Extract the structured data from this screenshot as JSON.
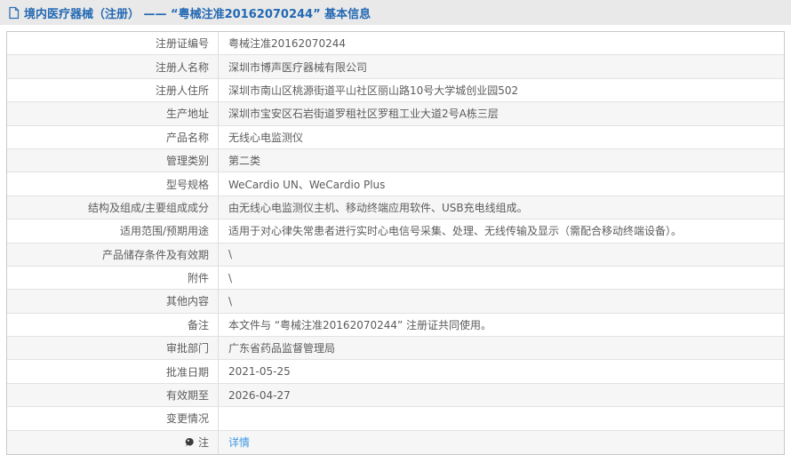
{
  "header": {
    "title": "境内医疗器械（注册） —— “粤械注准20162070244” 基本信息"
  },
  "colors": {
    "title_blue": "#2369b3",
    "link_blue": "#3e97e0",
    "header_bg": "#e9e9e9",
    "alt_row_bg": "#f6f6f6"
  },
  "icons": {
    "header": "document-icon",
    "note": "note-balloon-icon"
  },
  "table": {
    "rows": [
      {
        "label": "注册证编号",
        "value": "粤械注准20162070244"
      },
      {
        "label": "注册人名称",
        "value": "深圳市博声医疗器械有限公司"
      },
      {
        "label": "注册人住所",
        "value": "深圳市南山区桃源街道平山社区丽山路10号大学城创业园502"
      },
      {
        "label": "生产地址",
        "value": "深圳市宝安区石岩街道罗租社区罗租工业大道2号A栋三层"
      },
      {
        "label": "产品名称",
        "value": "无线心电监测仪"
      },
      {
        "label": "管理类别",
        "value": "第二类"
      },
      {
        "label": "型号规格",
        "value": "WeCardio UN、WeCardio Plus"
      },
      {
        "label": "结构及组成/主要组成成分",
        "value": "由无线心电监测仪主机、移动终端应用软件、USB充电线组成。"
      },
      {
        "label": "适用范围/预期用途",
        "value": "适用于对心律失常患者进行实时心电信号采集、处理、无线传输及显示（需配合移动终端设备）。"
      },
      {
        "label": "产品储存条件及有效期",
        "value": "\\"
      },
      {
        "label": "附件",
        "value": "\\"
      },
      {
        "label": "其他内容",
        "value": "\\"
      },
      {
        "label": "备注",
        "value": "本文件与 “粤械注准20162070244” 注册证共同使用。"
      },
      {
        "label": "审批部门",
        "value": "广东省药品监督管理局"
      },
      {
        "label": "批准日期",
        "value": "2021-05-25"
      },
      {
        "label": "有效期至",
        "value": "2026-04-27"
      },
      {
        "label": "变更情况",
        "value": ""
      },
      {
        "label": "注",
        "label_icon": "note-balloon-icon",
        "value": "详情",
        "value_is_link": true
      }
    ]
  }
}
